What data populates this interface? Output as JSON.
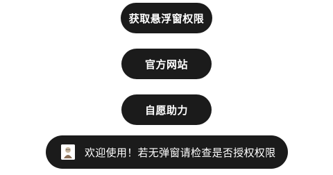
{
  "buttons": {
    "get_floating_permission": "获取悬浮窗权限",
    "official_website": "官方网站",
    "voluntary_support": "自愿助力"
  },
  "toast": {
    "icon": "app-icon",
    "message": "欢迎使用！若无弹窗请检查是否授权权限"
  },
  "colors": {
    "button_bg": "#1b1b1b",
    "button_text": "#ffffff",
    "page_bg": "#ffffff"
  }
}
